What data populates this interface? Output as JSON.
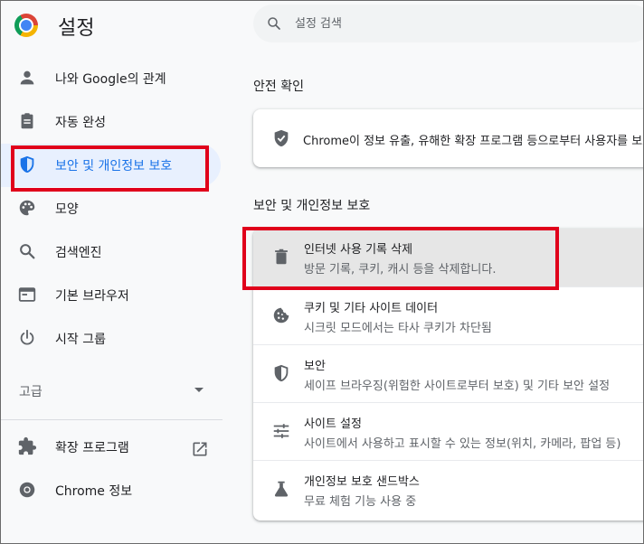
{
  "app": {
    "title": "설정"
  },
  "search": {
    "placeholder": "설정 검색"
  },
  "sidebar": {
    "items": [
      {
        "label": "나와 Google의 관계",
        "icon": "person-icon"
      },
      {
        "label": "자동 완성",
        "icon": "clipboard-icon"
      },
      {
        "label": "보안 및 개인정보 보호",
        "icon": "shield-icon",
        "active": true
      },
      {
        "label": "모양",
        "icon": "palette-icon"
      },
      {
        "label": "검색엔진",
        "icon": "search-icon"
      },
      {
        "label": "기본 브라우저",
        "icon": "browser-icon"
      },
      {
        "label": "시작 그룹",
        "icon": "power-icon"
      }
    ],
    "advanced": "고급",
    "extensions": "확장 프로그램",
    "about": "Chrome 정보"
  },
  "safety_check": {
    "title": "안전 확인",
    "text": "Chrome이 정보 유출, 유해한 확장 프로그램 등으로부터 사용자를 보호"
  },
  "privacy": {
    "title": "보안 및 개인정보 보호",
    "rows": [
      {
        "title": "인터넷 사용 기록 삭제",
        "desc": "방문 기록, 쿠키, 캐시 등을 삭제합니다.",
        "icon": "trash-icon"
      },
      {
        "title": "쿠키 및 기타 사이트 데이터",
        "desc": "시크릿 모드에서는 타사 쿠키가 차단됨",
        "icon": "cookie-icon"
      },
      {
        "title": "보안",
        "desc": "세이프 브라우징(위험한 사이트로부터 보호) 및 기타 보안 설정",
        "icon": "shield-icon"
      },
      {
        "title": "사이트 설정",
        "desc": "사이트에서 사용하고 표시할 수 있는 정보(위치, 카메라, 팝업 등)",
        "icon": "tune-icon"
      },
      {
        "title": "개인정보 보호 샌드박스",
        "desc": "무료 체험 기능 사용 중",
        "icon": "flask-icon"
      }
    ]
  },
  "colors": {
    "accent": "#1a73e8",
    "highlight": "#e0001b",
    "active_bg": "#e8f0fe",
    "icon": "#5f6368"
  }
}
